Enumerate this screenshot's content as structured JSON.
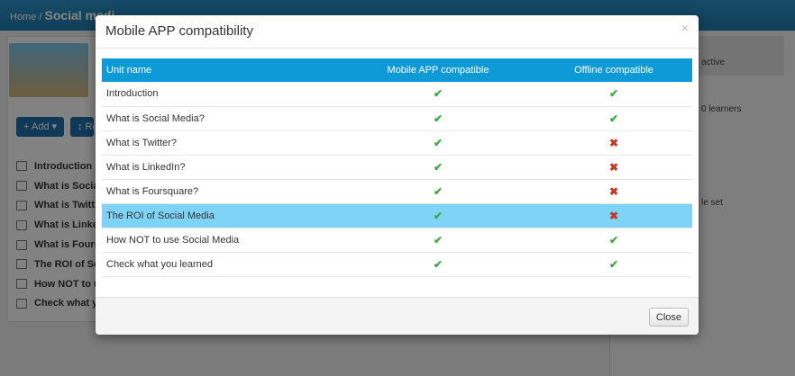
{
  "background": {
    "breadcrumb_home": "Home /",
    "breadcrumb_current": "Social medi",
    "buttons": [
      "+ Add ▾",
      "↕ Re"
    ],
    "units": [
      "Introduction",
      "What is Socia",
      "What is Twitt",
      "What is Linke",
      "What is Fours",
      "The ROI of So",
      "How NOT to u",
      "Check what y"
    ],
    "right_texts": [
      "active",
      "0 learners",
      "le set"
    ]
  },
  "modal": {
    "title": "Mobile APP compatibility",
    "close_icon": "×",
    "columns": [
      "Unit name",
      "Mobile APP compatible",
      "Offline compatible"
    ],
    "rows": [
      {
        "name": "Introduction",
        "mobile": true,
        "offline": true,
        "highlighted": false
      },
      {
        "name": "What is Social Media?",
        "mobile": true,
        "offline": true,
        "highlighted": false
      },
      {
        "name": "What is Twitter?",
        "mobile": true,
        "offline": false,
        "highlighted": false
      },
      {
        "name": "What is LinkedIn?",
        "mobile": true,
        "offline": false,
        "highlighted": false
      },
      {
        "name": "What is Foursquare?",
        "mobile": true,
        "offline": false,
        "highlighted": false
      },
      {
        "name": "The ROI of Social Media",
        "mobile": true,
        "offline": false,
        "highlighted": true
      },
      {
        "name": "How NOT to use Social Media",
        "mobile": true,
        "offline": true,
        "highlighted": false
      },
      {
        "name": "Check what you learned",
        "mobile": true,
        "offline": true,
        "highlighted": false
      }
    ],
    "close_label": "Close"
  },
  "icons": {
    "yes": "✔",
    "no": "✖"
  },
  "colors": {
    "header": "#0e9ad6",
    "highlight": "#7fd3f6",
    "check": "#3caa3c",
    "cross": "#c0392b"
  }
}
